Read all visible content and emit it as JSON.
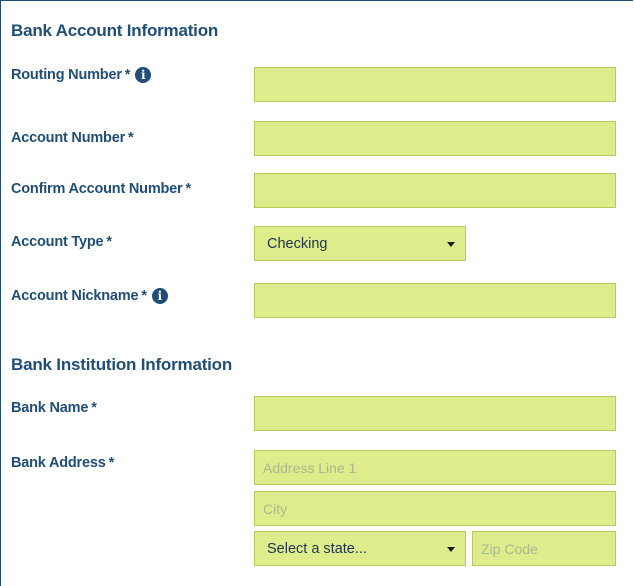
{
  "bank_account": {
    "title": "Bank Account Information",
    "routing_label": "Routing Number",
    "account_label": "Account Number",
    "confirm_label": "Confirm Account Number",
    "type_label": "Account Type",
    "type_value": "Checking",
    "nickname_label": "Account Nickname",
    "required_mark": "*",
    "info_icon_glyph": "i"
  },
  "bank_institution": {
    "title": "Bank Institution Information",
    "name_label": "Bank Name",
    "address_label": "Bank Address",
    "address_line1_placeholder": "Address Line 1",
    "city_placeholder": "City",
    "state_value": "Select a state...",
    "zip_placeholder": "Zip Code",
    "required_mark": "*"
  },
  "colors": {
    "heading": "#1f4e79",
    "field_bg": "#dfec8c",
    "field_border": "#b6cb5c"
  }
}
